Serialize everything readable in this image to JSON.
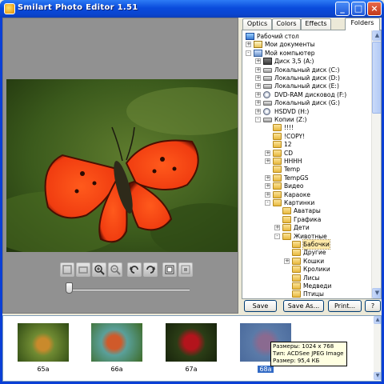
{
  "window": {
    "title": "Smilart Photo Editor 1.51"
  },
  "titlebar_buttons": [
    "minimize",
    "maximize",
    "close"
  ],
  "tabs": [
    {
      "label": "Optics"
    },
    {
      "label": "Colors"
    },
    {
      "label": "Effects"
    },
    {
      "label": "Folders",
      "active": true
    }
  ],
  "tree": [
    {
      "label": "Рабочий стол",
      "depth": 0,
      "icon": "desktop-icon",
      "expander": ""
    },
    {
      "label": "Мои документы",
      "depth": 1,
      "icon": "documents-icon",
      "expander": "+"
    },
    {
      "label": "Мой компьютер",
      "depth": 1,
      "icon": "computer-icon",
      "expander": "-"
    },
    {
      "label": "Диск 3,5 (A:)",
      "depth": 2,
      "icon": "floppy-icon",
      "expander": "+"
    },
    {
      "label": "Локальный диск (C:)",
      "depth": 2,
      "icon": "drive-icon",
      "expander": "+"
    },
    {
      "label": "Локальный диск (D:)",
      "depth": 2,
      "icon": "drive-icon",
      "expander": "+"
    },
    {
      "label": "Локальный диск (E:)",
      "depth": 2,
      "icon": "drive-icon",
      "expander": "+"
    },
    {
      "label": "DVD-RAM дисковод (F:)",
      "depth": 2,
      "icon": "dvd-icon",
      "expander": "+"
    },
    {
      "label": "Локальный диск (G:)",
      "depth": 2,
      "icon": "drive-icon",
      "expander": "+"
    },
    {
      "label": "HSDVD (H:)",
      "depth": 2,
      "icon": "dvd-icon",
      "expander": "+"
    },
    {
      "label": "Копии (Z:)",
      "depth": 2,
      "icon": "drive-icon",
      "expander": "-"
    },
    {
      "label": "!!!!",
      "depth": 3,
      "icon": "folder-icon",
      "expander": ""
    },
    {
      "label": "!COPY!",
      "depth": 3,
      "icon": "folder-icon",
      "expander": ""
    },
    {
      "label": "12",
      "depth": 3,
      "icon": "folder-icon",
      "expander": ""
    },
    {
      "label": "CD",
      "depth": 3,
      "icon": "folder-icon",
      "expander": "+"
    },
    {
      "label": "HHHH",
      "depth": 3,
      "icon": "folder-icon",
      "expander": "+"
    },
    {
      "label": "Temp",
      "depth": 3,
      "icon": "folder-icon",
      "expander": ""
    },
    {
      "label": "TempGS",
      "depth": 3,
      "icon": "folder-icon",
      "expander": "+"
    },
    {
      "label": "Видео",
      "depth": 3,
      "icon": "folder-icon",
      "expander": "+"
    },
    {
      "label": "Караоке",
      "depth": 3,
      "icon": "folder-icon",
      "expander": "+"
    },
    {
      "label": "Картинки",
      "depth": 3,
      "icon": "folder-icon",
      "expander": "-"
    },
    {
      "label": "Аватары",
      "depth": 4,
      "icon": "folder-icon",
      "expander": ""
    },
    {
      "label": "Графика",
      "depth": 4,
      "icon": "folder-icon",
      "expander": ""
    },
    {
      "label": "Дети",
      "depth": 4,
      "icon": "folder-icon",
      "expander": "+"
    },
    {
      "label": "Животные",
      "depth": 4,
      "icon": "folder-icon",
      "expander": "-"
    },
    {
      "label": "Бабочки",
      "depth": 5,
      "icon": "folder-icon",
      "expander": "",
      "selected": true
    },
    {
      "label": "Другие",
      "depth": 5,
      "icon": "folder-icon",
      "expander": ""
    },
    {
      "label": "Кошки",
      "depth": 5,
      "icon": "folder-icon",
      "expander": "+"
    },
    {
      "label": "Кролики",
      "depth": 5,
      "icon": "folder-icon",
      "expander": ""
    },
    {
      "label": "Лисы",
      "depth": 5,
      "icon": "folder-icon",
      "expander": ""
    },
    {
      "label": "Медведи",
      "depth": 5,
      "icon": "folder-icon",
      "expander": ""
    },
    {
      "label": "Птицы",
      "depth": 5,
      "icon": "folder-icon",
      "expander": ""
    }
  ],
  "buttons": {
    "save": "Save",
    "save_as": "Save As...",
    "print": "Print...",
    "help": "?"
  },
  "toolbar_icons": [
    "crop-icon",
    "resize-icon",
    "zoom-in-icon",
    "zoom-out-icon",
    "rotate-left-icon",
    "rotate-right-icon",
    "fit-icon",
    "actual-size-icon"
  ],
  "zoom_level": 0.02,
  "thumbnails": [
    {
      "caption": "65a",
      "selected": false,
      "subject": "butterfly-thumbnail"
    },
    {
      "caption": "66a",
      "selected": false,
      "subject": "butterfly-thumbnail"
    },
    {
      "caption": "67a",
      "selected": false,
      "subject": "butterfly-thumbnail"
    },
    {
      "caption": "68a",
      "selected": true,
      "subject": "butterfly-thumbnail"
    }
  ],
  "tooltip": {
    "size": "Размеры: 1024 x 768",
    "type": "Тип: ACDSee JPEG Image",
    "weight": "Размер: 95,4 КБ"
  },
  "colors": {
    "titlebar": "#0a4bdc",
    "preview_bg": "#919191",
    "selection": "#316ac5",
    "tree_highlight": "#ffe9a8"
  }
}
